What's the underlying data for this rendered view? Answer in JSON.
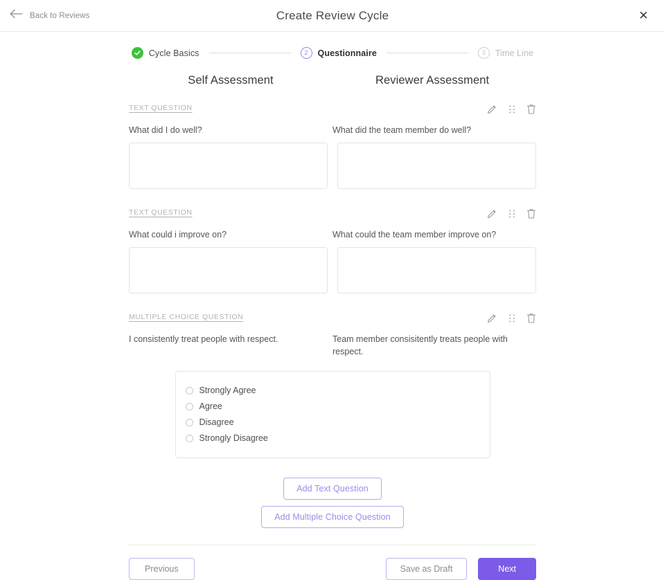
{
  "header": {
    "back_label": "Back to Reviews",
    "title": "Create Review Cycle",
    "close_glyph": "✕"
  },
  "stepper": {
    "steps": [
      {
        "number": "1",
        "label": "Cycle Basics",
        "state": "done"
      },
      {
        "number": "2",
        "label": "Questionnaire",
        "state": "current"
      },
      {
        "number": "3",
        "label": "Time Line",
        "state": "todo"
      }
    ]
  },
  "columns": {
    "self": "Self Assessment",
    "reviewer": "Reviewer Assessment"
  },
  "questions": [
    {
      "tag": "TEXT QUESTION",
      "self_text": "What did I do well?",
      "reviewer_text": "What did the team member do well?",
      "self_value": "",
      "reviewer_value": ""
    },
    {
      "tag": "TEXT QUESTION",
      "self_text": "What could i improve on?",
      "reviewer_text": "What could the team member improve on?",
      "self_value": "",
      "reviewer_value": ""
    },
    {
      "tag": "MULTIPLE CHOICE QUESTION",
      "self_text": "I consistently treat people with respect.",
      "reviewer_text": "Team member consisitently treats people with respect.",
      "choices": [
        {
          "label": "Strongly Agree",
          "selected": false
        },
        {
          "label": "Agree",
          "selected": false
        },
        {
          "label": "Disagree",
          "selected": false
        },
        {
          "label": "Strongly Disagree",
          "selected": false
        }
      ]
    }
  ],
  "tools": {
    "edit": "pencil-icon",
    "drag": "drag-handle-icon",
    "delete": "trash-icon"
  },
  "actions": {
    "add_text": "Add Text Question",
    "add_multiple_choice": "Add Multiple Choice Question"
  },
  "footer": {
    "previous": "Previous",
    "save_draft": "Save as Draft",
    "next": "Next"
  },
  "colors": {
    "accent_purple": "#7b5be8",
    "accent_purple_light": "#9d8bea",
    "step_done_green": "#3ec13e",
    "border_gray": "#e4e4e7",
    "text_dark": "#3a3a3e",
    "text_muted": "#8d8d92"
  }
}
